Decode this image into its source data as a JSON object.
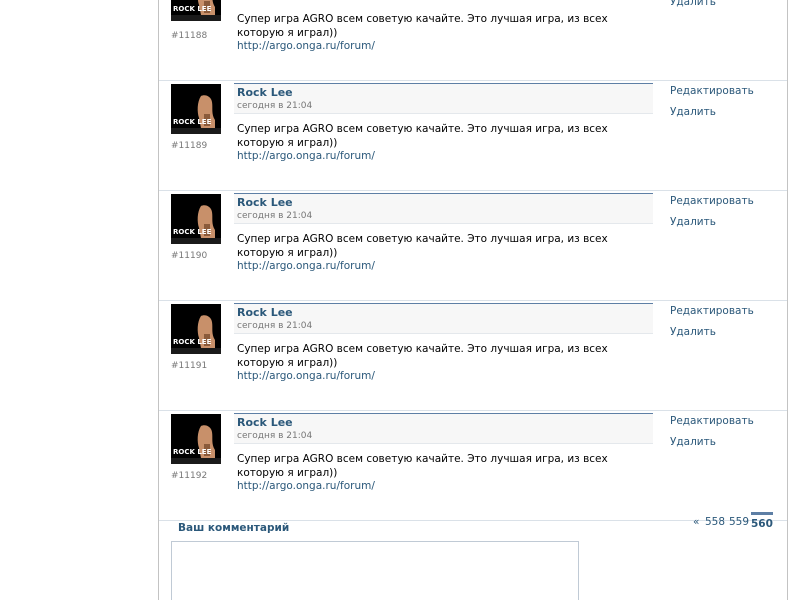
{
  "posts": [
    {
      "number": "#11188",
      "author": "",
      "date": "",
      "text": "Супер игра AGRO всем советую качайте. Это лучшая игра, из всех которую я играл))",
      "link": "http://argo.onga.ru/forum/",
      "edit_label": "",
      "delete_label": "Удалить",
      "avatar_caption": "ROCK LEE"
    },
    {
      "number": "#11189",
      "author": "Rock Lee",
      "date": "сегодня в 21:04",
      "text": "Супер игра AGRO всем советую качайте. Это лучшая игра, из всех которую я играл))",
      "link": "http://argo.onga.ru/forum/",
      "edit_label": "Редактировать",
      "delete_label": "Удалить",
      "avatar_caption": "ROCK LEE"
    },
    {
      "number": "#11190",
      "author": "Rock Lee",
      "date": "сегодня в 21:04",
      "text": "Супер игра AGRO всем советую качайте. Это лучшая игра, из всех которую я играл))",
      "link": "http://argo.onga.ru/forum/",
      "edit_label": "Редактировать",
      "delete_label": "Удалить",
      "avatar_caption": "ROCK LEE"
    },
    {
      "number": "#11191",
      "author": "Rock Lee",
      "date": "сегодня в 21:04",
      "text": "Супер игра AGRO всем советую качайте. Это лучшая игра, из всех которую я играл))",
      "link": "http://argo.onga.ru/forum/",
      "edit_label": "Редактировать",
      "delete_label": "Удалить",
      "avatar_caption": "ROCK LEE"
    },
    {
      "number": "#11192",
      "author": "Rock Lee",
      "date": "сегодня в 21:04",
      "text": "Супер игра AGRO всем советую качайте. Это лучшая игра, из всех которую я играл))",
      "link": "http://argo.onga.ru/forum/",
      "edit_label": "Редактировать",
      "delete_label": "Удалить",
      "avatar_caption": "ROCK LEE"
    }
  ],
  "comment": {
    "label": "Ваш комментарий",
    "value": ""
  },
  "pagination": {
    "prev": "«",
    "pages": [
      "558",
      "559"
    ],
    "current": "560"
  },
  "colors": {
    "link": "#2b587a",
    "header_border": "#5e7fa5",
    "header_bg": "#f7f7f7",
    "divider": "#dae1e8"
  }
}
